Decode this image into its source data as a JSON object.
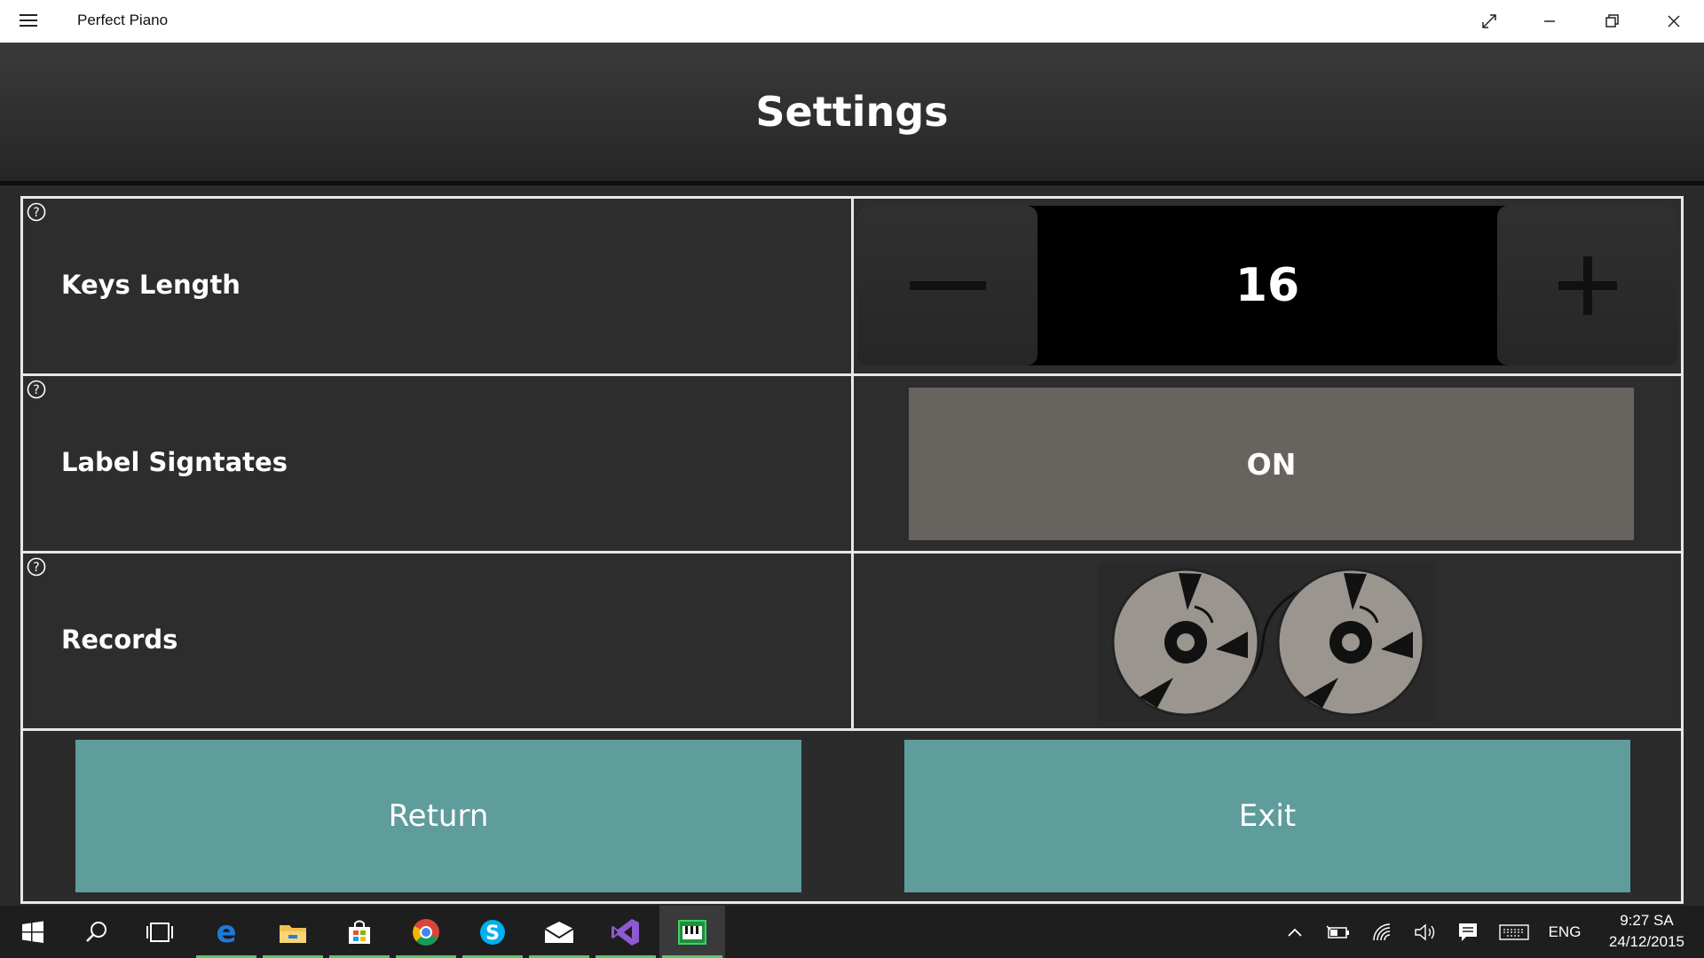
{
  "window": {
    "title": "Perfect Piano",
    "controls": [
      "expand-icon",
      "minimize-icon",
      "restore-icon",
      "close-icon"
    ]
  },
  "header": {
    "title": "Settings"
  },
  "settings": {
    "rows": [
      {
        "label": "Keys Length",
        "control": "stepper",
        "value": "16",
        "icons": [
          "minus-icon",
          "plus-icon"
        ]
      },
      {
        "label": "Label Signtates",
        "control": "toggle",
        "value": "ON"
      },
      {
        "label": "Records",
        "control": "button",
        "icon": "tape-reels-icon"
      }
    ]
  },
  "actions": {
    "return_label": "Return",
    "exit_label": "Exit"
  },
  "colors": {
    "accent_button": "#5f9c9c",
    "toggle_on": "#67635e",
    "background": "#2b2b2b",
    "taskbar_indicator": "#5fc46a"
  },
  "taskbar": {
    "apps": [
      "windows-start-icon",
      "search-icon",
      "task-view-icon",
      "edge-icon",
      "file-explorer-icon",
      "store-icon",
      "chrome-icon",
      "skype-icon",
      "mail-icon",
      "visual-studio-icon",
      "piano-app-icon"
    ],
    "tray": [
      "chevron-up-icon",
      "battery-icon",
      "wifi-icon",
      "volume-icon",
      "action-center-icon",
      "keyboard-icon"
    ],
    "language": "ENG",
    "time": "9:27 SA",
    "date": "24/12/2015"
  }
}
